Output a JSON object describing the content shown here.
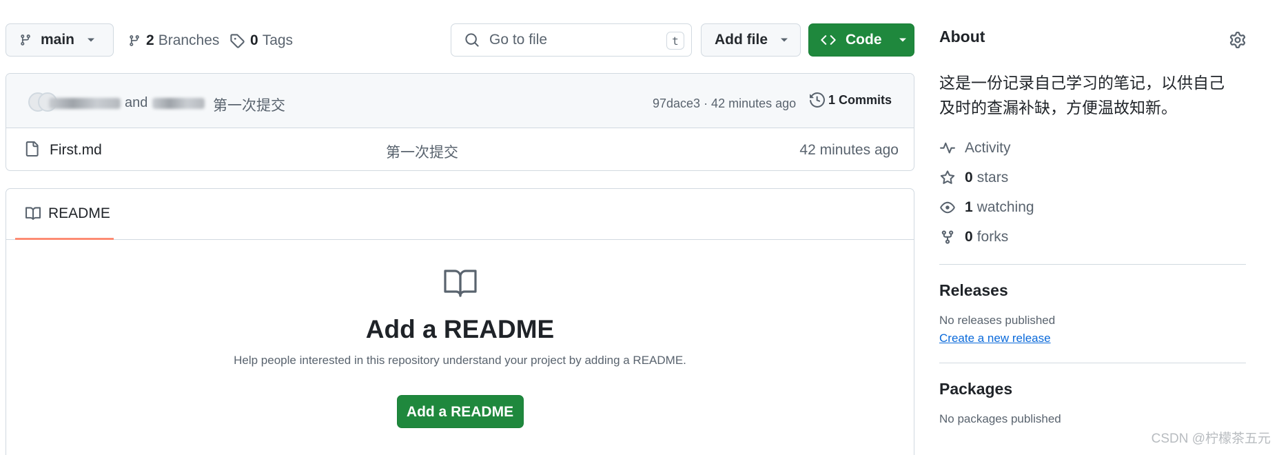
{
  "toolbar": {
    "branch": "main",
    "branches_count": "2",
    "branches_label": "Branches",
    "tags_count": "0",
    "tags_label": "Tags",
    "goto_placeholder": "Go to file",
    "goto_shortcut": "t",
    "add_file_label": "Add file",
    "code_label": "Code"
  },
  "commit": {
    "and_text": "and",
    "message": "第一次提交",
    "meta": "97dace3 · 42 minutes ago",
    "commits_label": "1 Commits"
  },
  "files": [
    {
      "name": "First.md",
      "message": "第一次提交",
      "age": "42 minutes ago"
    }
  ],
  "readme": {
    "tab_label": "README",
    "title": "Add a README",
    "description": "Help people interested in this repository understand your project by adding a README.",
    "cta_label": "Add a README"
  },
  "about": {
    "title": "About",
    "description": "这是一份记录自己学习的笔记，以供自己及时的查漏补缺，方便温故知新。",
    "activity_label": "Activity",
    "stars_count": "0",
    "stars_label": "stars",
    "watching_count": "1",
    "watching_label": "watching",
    "forks_count": "0",
    "forks_label": "forks"
  },
  "releases": {
    "title": "Releases",
    "empty_text": "No releases published",
    "create_link": "Create a new release"
  },
  "packages": {
    "title": "Packages",
    "empty_text": "No packages published"
  },
  "watermark": "CSDN @柠檬茶五元",
  "colors": {
    "primary_green": "#1f883d",
    "link_blue": "#0969da",
    "tab_underline": "#fd8c73",
    "muted_text": "#59636e",
    "border": "#d1d9e0"
  },
  "icons": [
    "branch-icon",
    "tag-icon",
    "search-icon",
    "code-icon",
    "history-icon",
    "file-icon",
    "book-icon",
    "gear-icon",
    "pulse-icon",
    "star-icon",
    "eye-icon",
    "fork-icon"
  ]
}
